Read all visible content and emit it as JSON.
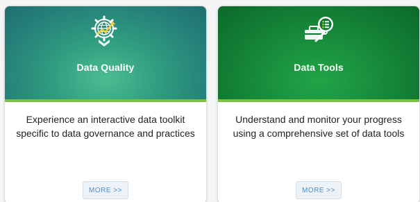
{
  "cards": [
    {
      "title": "Data Quality",
      "description": "Experience an interactive  data toolkit specific to data governance and practices",
      "more_label": "MORE >>",
      "icon": "globe-gear-chart-icon",
      "colors": {
        "header": "#257f79",
        "accent_bar": "#7cc142"
      }
    },
    {
      "title": "Data Tools",
      "description": "Understand and monitor your progress using a comprehensive set of data tools",
      "more_label": "MORE >>",
      "icon": "toolbox-checklist-icon",
      "colors": {
        "header": "#0f7530",
        "accent_bar": "#7cc142"
      }
    }
  ]
}
